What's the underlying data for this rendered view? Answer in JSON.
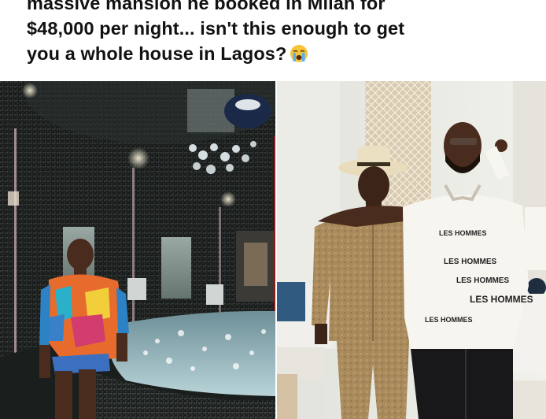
{
  "post": {
    "caption_lines": [
      "massive mansion he booked in Milan for",
      "$48,000 per night... isn't this enough to get",
      "you a whole house in Lagos?"
    ],
    "emoji": "crying-face-icon"
  },
  "photos": {
    "right": {
      "shirt_text": [
        "LES HOMMES",
        "LES HOMMES",
        "LES HOMMES",
        "LES HOMMES",
        "LES HOMMES"
      ]
    }
  },
  "colors": {
    "caption_text": "#121212",
    "background": "#ffffff"
  }
}
